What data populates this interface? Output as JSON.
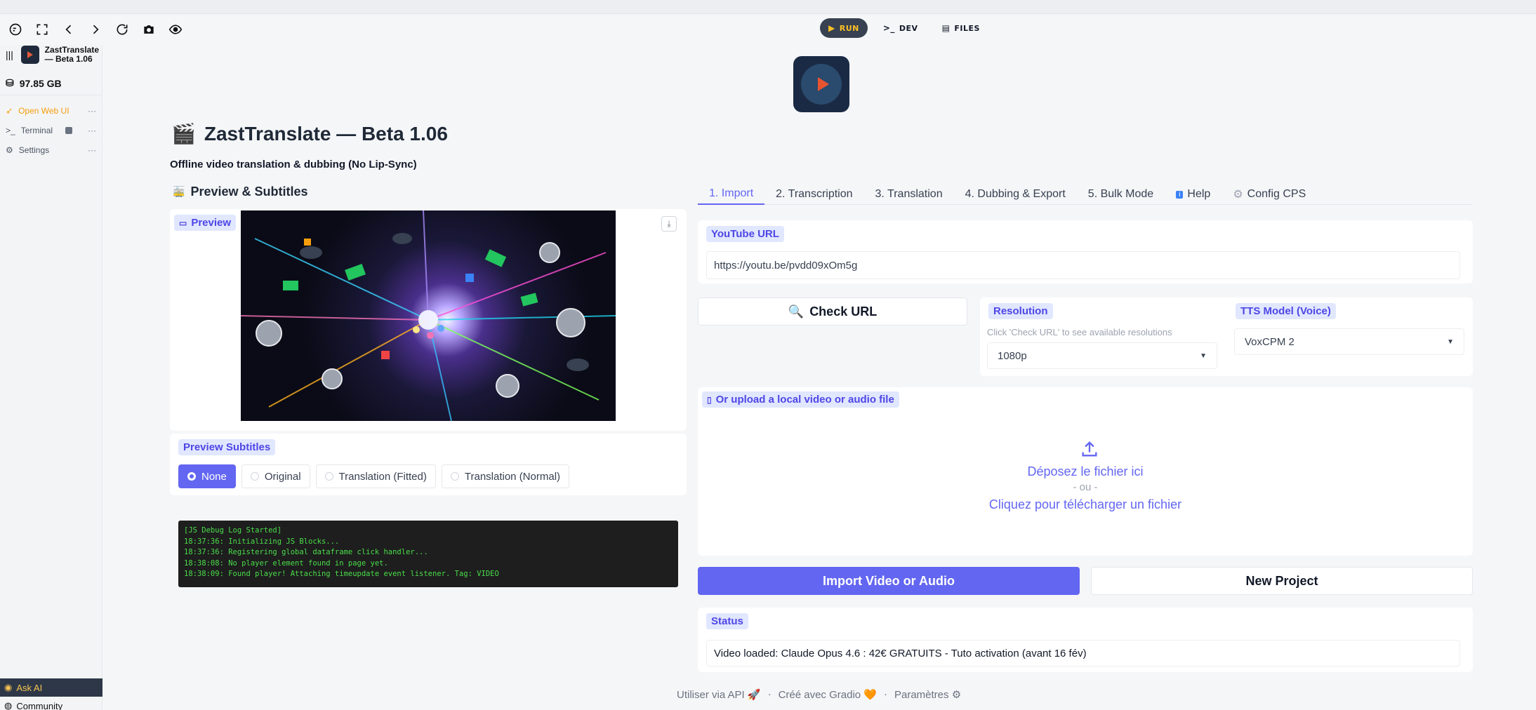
{
  "toolbar": {
    "modes": [
      {
        "label": "RUN",
        "icon": "play-circle-icon",
        "active": true
      },
      {
        "label": "DEV",
        "icon": "terminal-icon",
        "active": false
      },
      {
        "label": "FILES",
        "icon": "file-icon",
        "active": false
      }
    ]
  },
  "sidebar": {
    "app_name_line1": "ZastTranslate",
    "app_name_line2": "— Beta 1.06",
    "storage": "97.85 GB",
    "items": [
      {
        "label": "Open Web UI",
        "icon": "rocket-icon"
      },
      {
        "label": "Terminal",
        "icon": "terminal-icon"
      },
      {
        "label": "Settings",
        "icon": "gear-icon"
      }
    ],
    "ask_ai": "Ask AI",
    "community": "Community"
  },
  "header": {
    "title": "ZastTranslate — Beta 1.06",
    "subtitle": "Offline video translation & dubbing (No Lip-Sync)"
  },
  "left": {
    "section_title": "Preview & Subtitles",
    "preview_label": "Preview",
    "subtitles_label": "Preview Subtitles",
    "subtitle_options": [
      "None",
      "Original",
      "Translation (Fitted)",
      "Translation (Normal)"
    ],
    "selected_option": "None",
    "log_lines": [
      "[JS Debug Log Started]",
      "18:37:36: Initializing JS Blocks...",
      "18:37:36: Registering global dataframe click handler...",
      "18:38:08: No player element found in page yet.",
      "18:38:09: Found player! Attaching timeupdate event listener. Tag: VIDEO"
    ]
  },
  "tabs": [
    "1. Import",
    "2. Transcription",
    "3. Translation",
    "4. Dubbing & Export",
    "5. Bulk Mode",
    "Help",
    "Config CPS"
  ],
  "import": {
    "youtube_label": "YouTube URL",
    "youtube_value": "https://youtu.be/pvdd09xOm5g",
    "check_button": "Check URL",
    "resolution_label": "Resolution",
    "resolution_hint": "Click 'Check URL' to see available resolutions",
    "resolution_value": "1080p",
    "tts_label": "TTS Model (Voice)",
    "tts_value": "VoxCPM 2",
    "upload_label": "Or upload a local video or audio file",
    "upload_drop": "Déposez le fichier ici",
    "upload_or": "- ou -",
    "upload_click": "Cliquez pour télécharger un fichier",
    "import_button": "Import Video or Audio",
    "new_project_button": "New Project",
    "status_label": "Status",
    "status_value": "Video loaded: Claude Opus 4.6 : 42€ GRATUITS - Tuto activation (avant 16 fév)"
  },
  "footer": {
    "api": "Utiliser via API",
    "gradio": "Créé avec Gradio",
    "settings": "Paramètres",
    "separator": "·"
  },
  "colors": {
    "accent": "#6366f1",
    "chip_bg": "#e0e7ff",
    "log_bg": "#1e1e1e",
    "log_text": "#4ade4a"
  }
}
